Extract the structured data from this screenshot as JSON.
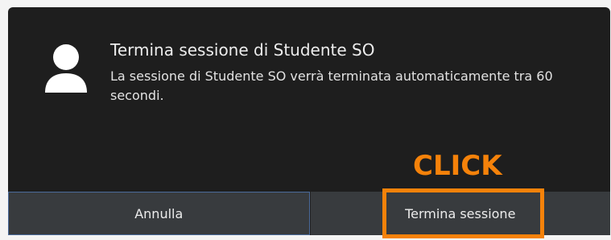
{
  "dialog": {
    "title": "Termina sessione di Studente SO",
    "message": "La sessione di Studente SO verrà terminata automaticamente tra 60 secondi.",
    "avatar_icon": "user-avatar-icon"
  },
  "buttons": {
    "cancel_label": "Annulla",
    "logout_label": "Termina sessione"
  },
  "annotation": {
    "label": "CLICK",
    "color": "#f5820a"
  },
  "colors": {
    "dialog_background": "#1e1e1e",
    "button_background": "#383b3e",
    "focus_border": "#4a6a9a"
  }
}
